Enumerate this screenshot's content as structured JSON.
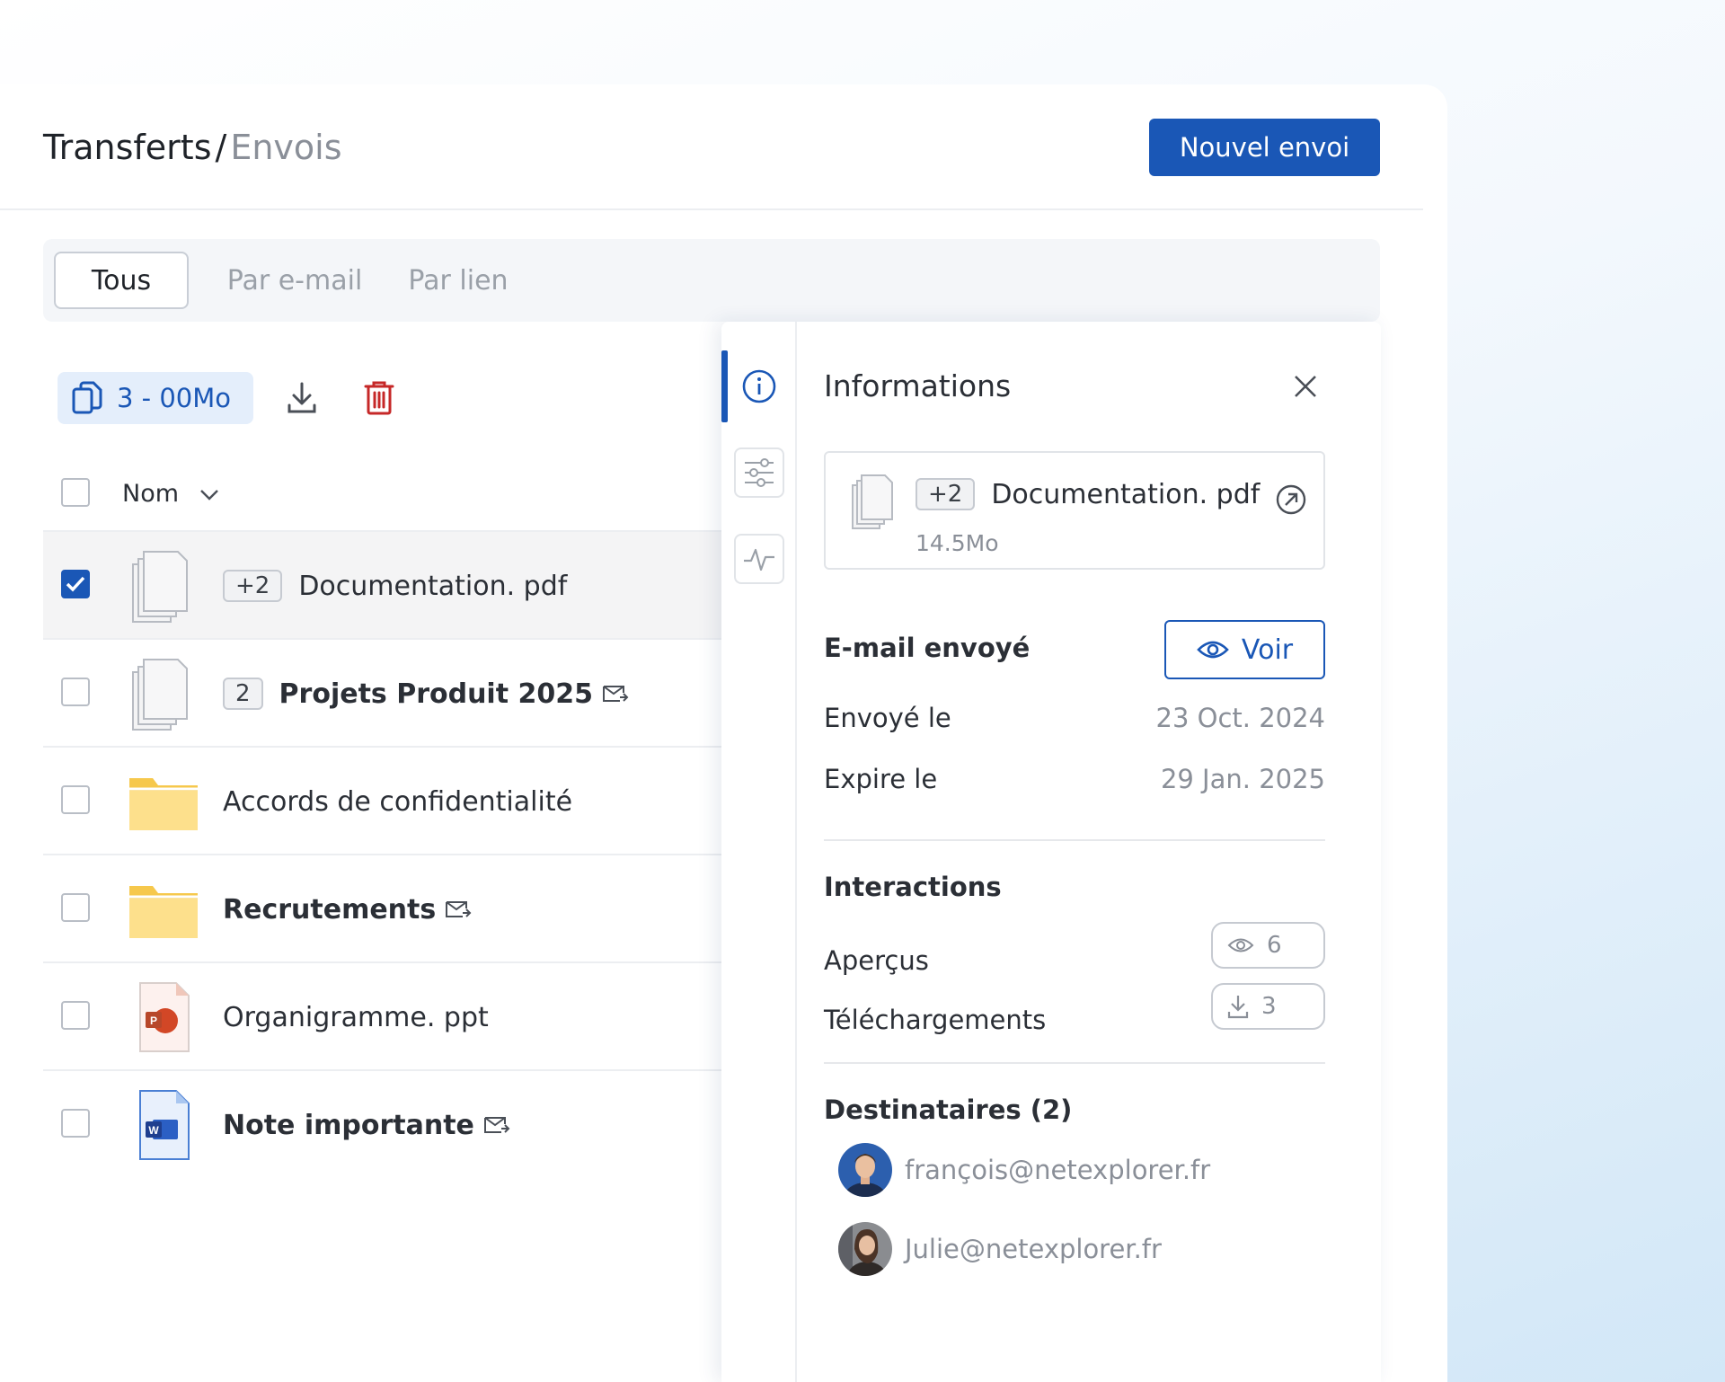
{
  "header": {
    "breadcrumb_root": "Transferts",
    "breadcrumb_sep": "/",
    "breadcrumb_current": "Envois",
    "new_button": "Nouvel envoi"
  },
  "tabs": [
    {
      "label": "Tous",
      "active": true
    },
    {
      "label": "Par e-mail",
      "active": false
    },
    {
      "label": "Par lien",
      "active": false
    }
  ],
  "toolbar": {
    "selection_label": "3 - 00Mo",
    "download_icon": "download-icon",
    "delete_icon": "trash-icon"
  },
  "list": {
    "column_name": "Nom",
    "rows": [
      {
        "badge": "+2",
        "name": "Documentation. pdf",
        "icon": "multi-file-icon",
        "checked": true,
        "bold": false,
        "mail": false
      },
      {
        "badge": "2",
        "name": "Projets Produit 2025",
        "icon": "multi-file-icon",
        "checked": false,
        "bold": true,
        "mail": true
      },
      {
        "badge": "",
        "name": "Accords de confidentialité",
        "icon": "folder-icon",
        "checked": false,
        "bold": false,
        "mail": false
      },
      {
        "badge": "",
        "name": "Recrutements",
        "icon": "folder-icon",
        "checked": false,
        "bold": true,
        "mail": true
      },
      {
        "badge": "",
        "name": "Organigramme. ppt",
        "icon": "powerpoint-file-icon",
        "checked": false,
        "bold": false,
        "mail": false
      },
      {
        "badge": "",
        "name": "Note importante",
        "icon": "word-file-icon",
        "checked": false,
        "bold": true,
        "mail": true
      }
    ]
  },
  "panel": {
    "title": "Informations",
    "file": {
      "badge": "+2",
      "name": "Documentation. pdf",
      "size": "14.5Mo"
    },
    "email_sent_label": "E-mail envoyé",
    "view_button": "Voir",
    "sent_label": "Envoyé le",
    "sent_value": "23 Oct. 2024",
    "expires_label": "Expire le",
    "expires_value": "29 Jan. 2025",
    "interactions_title": "Interactions",
    "previews_label": "Aperçus",
    "previews_count": "6",
    "downloads_label": "Téléchargements",
    "downloads_count": "3",
    "recipients_title": "Destinataires (2)",
    "recipients": [
      {
        "email": "françois@netexplorer.fr"
      },
      {
        "email": "Julie@netexplorer.fr"
      }
    ]
  },
  "colors": {
    "accent": "#1a57b6",
    "danger": "#c62828",
    "folder": "#f6c84c"
  }
}
